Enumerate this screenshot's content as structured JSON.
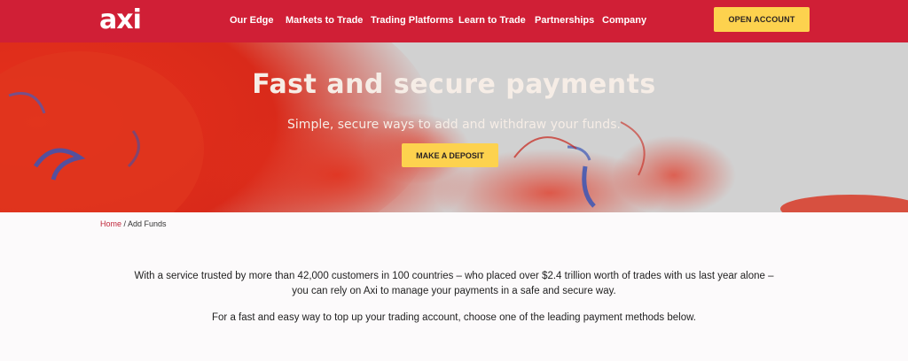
{
  "brand": {
    "logo_text": "axi",
    "primary_color": "#d01f36",
    "accent_color": "#fdd24e"
  },
  "nav": {
    "items": [
      {
        "label": "Our Edge"
      },
      {
        "label": "Markets to Trade"
      },
      {
        "label": "Trading Platforms"
      },
      {
        "label": "Learn to Trade"
      },
      {
        "label": "Partnerships"
      },
      {
        "label": "Company"
      }
    ],
    "cta_label": "OPEN ACCOUNT"
  },
  "hero": {
    "title": "Fast and secure payments",
    "subtitle": "Simple, secure ways to add and withdraw your funds.",
    "button_label": "MAKE A DEPOSIT"
  },
  "breadcrumb": {
    "home": "Home",
    "separator": " / ",
    "current": "Add Funds"
  },
  "content": {
    "paragraph1": "With a service trusted by more than 42,000 customers in 100 countries – who placed over $2.4 trillion worth of trades with us last year alone – you can rely on Axi to manage your payments in a safe and secure way.",
    "paragraph2": "For a fast and easy way to top up your trading account, choose one of the leading payment methods below."
  }
}
